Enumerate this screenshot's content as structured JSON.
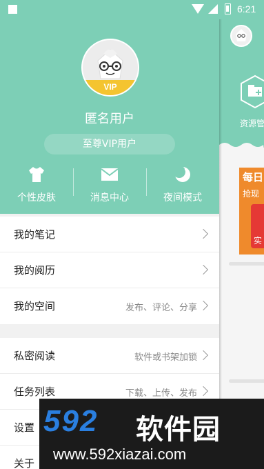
{
  "status_bar": {
    "time": "6:21"
  },
  "drawer": {
    "avatar_badge": "VIP",
    "username": "匿名用户",
    "vip_label": "至尊VIP用户",
    "quick_actions": [
      {
        "label": "个性皮肤",
        "icon": "tshirt-icon"
      },
      {
        "label": "消息中心",
        "icon": "envelope-icon"
      },
      {
        "label": "夜间模式",
        "icon": "moon-icon"
      }
    ],
    "menu_group_1": [
      {
        "label": "我的笔记",
        "hint": ""
      },
      {
        "label": "我的阅历",
        "hint": ""
      },
      {
        "label": "我的空间",
        "hint": "发布、评论、分享"
      }
    ],
    "menu_group_2": [
      {
        "label": "私密阅读",
        "hint": "软件或书架加锁"
      },
      {
        "label": "任务列表",
        "hint": "下载、上传、发布"
      },
      {
        "label": "设置",
        "hint": ""
      },
      {
        "label": "关于",
        "hint": ""
      }
    ]
  },
  "peek": {
    "hex_label": "资源管",
    "banner_title": "每日",
    "banner_sub": "抢现",
    "red_text": "实"
  },
  "watermark": {
    "brand_num": "592",
    "brand_cn": "软件园",
    "url": "www.592xiazai.com"
  },
  "colors": {
    "accent": "#7dcfb6",
    "vip": "#f4c430",
    "banner": "#ef8a2c"
  }
}
